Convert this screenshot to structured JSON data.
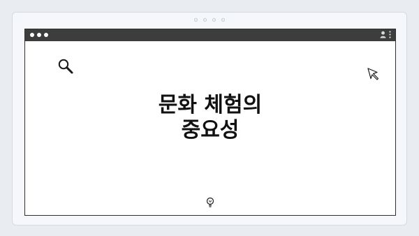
{
  "window": {
    "controls": [
      "close",
      "minimize",
      "maximize"
    ]
  },
  "toolbar": {
    "icons": [
      "user-icon",
      "more-vertical-icon"
    ]
  },
  "main": {
    "title_lines": [
      "문화 체험의",
      "중요성"
    ],
    "icons": [
      "search-icon",
      "cursor-icon",
      "lightbulb-icon"
    ]
  },
  "colors": {
    "titlebar": "#3d3d3d",
    "page_background": "#e9edf2",
    "text": "#111111"
  }
}
